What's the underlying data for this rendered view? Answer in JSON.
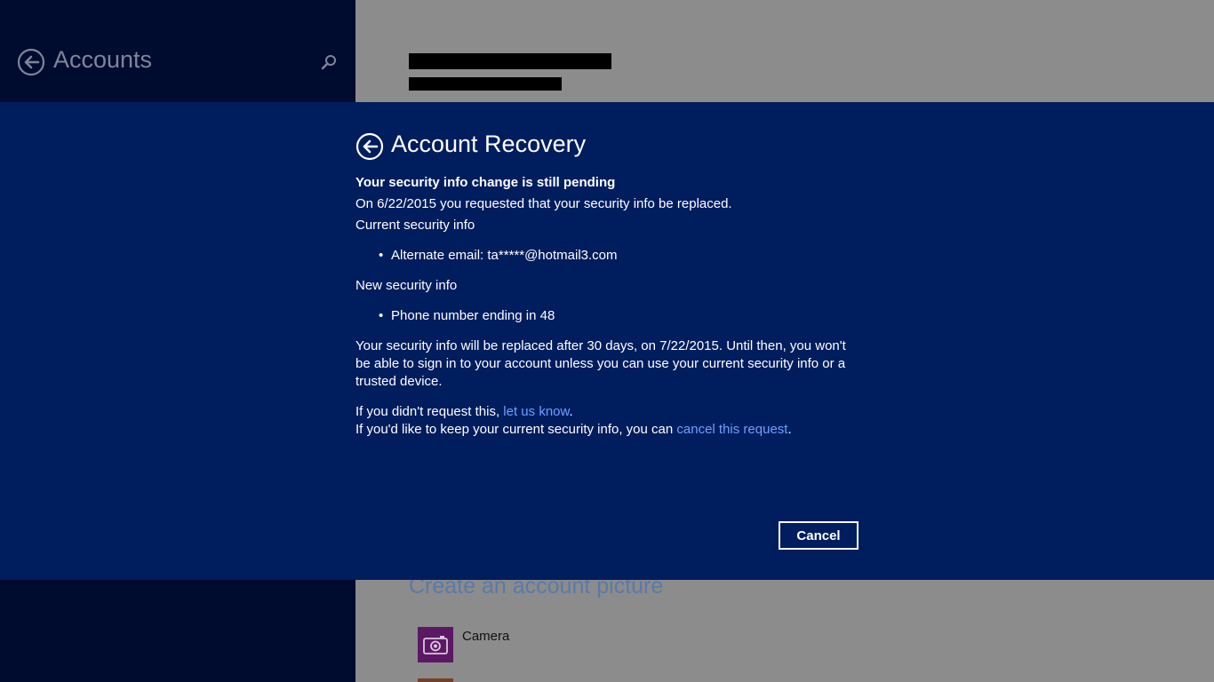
{
  "left_pane": {
    "title": "Accounts",
    "back_icon": "back-arrow-icon",
    "search_icon": "search-icon"
  },
  "right_pane": {
    "section_title": "Create an account picture",
    "camera_label": "Camera",
    "camera_icon": "camera-icon"
  },
  "dialog": {
    "title": "Account Recovery",
    "heading": "Your security info change is still pending",
    "request_line": "On 6/22/2015 you requested that your security info be replaced.",
    "current_label": "Current security info",
    "current_items": [
      "Alternate email: ta*****@hotmail3.com"
    ],
    "new_label": "New security info",
    "new_items": [
      "Phone number ending in 48"
    ],
    "replace_notice": "Your security info will be replaced after 30 days, on 7/22/2015. Until then, you won't be able to sign in to your account unless you can use your current security info or a trusted device.",
    "didnt_request_prefix": "If you didn't request this, ",
    "let_us_know_link": "let us know",
    "didnt_request_suffix": ".",
    "keep_prefix": "If you'd like to keep your current security info, you can ",
    "cancel_request_link": "cancel this request",
    "keep_suffix": ".",
    "cancel_button": "Cancel"
  },
  "colors": {
    "dialog_bg": "#001d5e",
    "link": "#6ca0ff",
    "left_pane_bg": "#000b30"
  }
}
